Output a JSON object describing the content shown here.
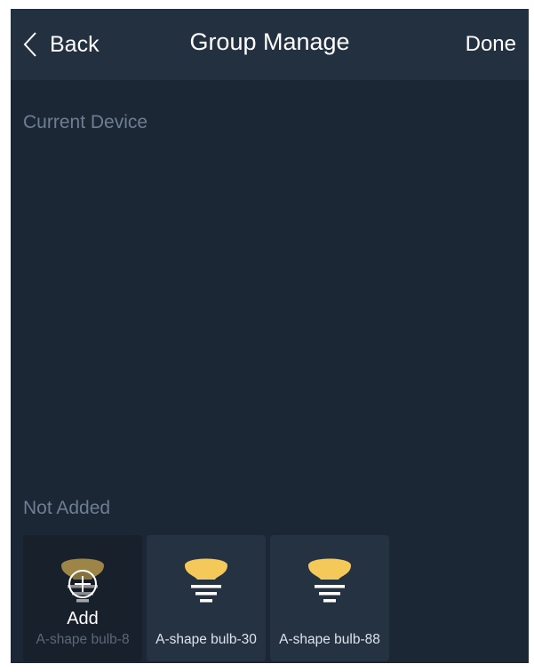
{
  "header": {
    "back_label": "Back",
    "title": "Group Manage",
    "done_label": "Done"
  },
  "sections": {
    "current_device": "Current Device",
    "not_added": "Not Added"
  },
  "devices": [
    {
      "name": "A-shape bulb-8",
      "selected": true,
      "overlay_label": "Add",
      "icon": "bulb-icon"
    },
    {
      "name": "A-shape bulb-30",
      "selected": false,
      "icon": "bulb-icon"
    },
    {
      "name": "A-shape bulb-88",
      "selected": false,
      "icon": "bulb-icon"
    }
  ],
  "colors": {
    "background": "#1b2735",
    "header": "#223040",
    "tile": "#243242",
    "tile_selected": "#18202b",
    "bulb": "#f5c85a",
    "muted_text": "#6e7e91"
  }
}
